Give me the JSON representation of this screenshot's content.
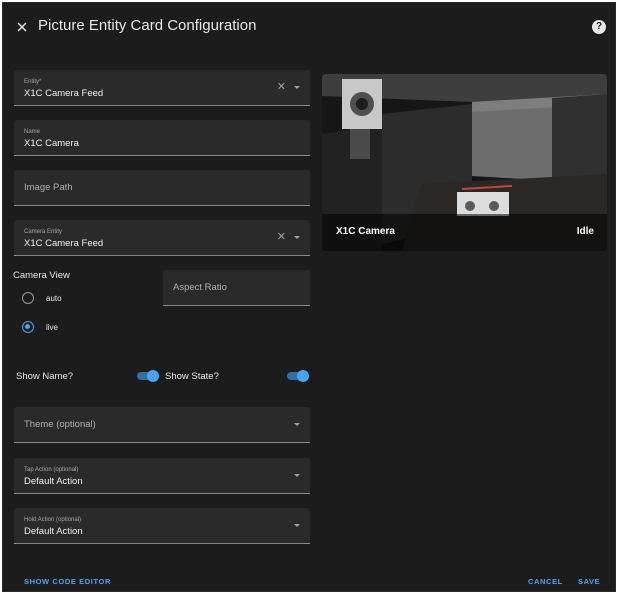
{
  "dialog": {
    "title": "Picture Entity Card Configuration"
  },
  "fields": {
    "entity": {
      "label": "Entity*",
      "value": "X1C Camera Feed"
    },
    "name": {
      "label": "Name",
      "value": "X1C Camera"
    },
    "image_path": {
      "placeholder": "Image Path"
    },
    "camera_entity": {
      "label": "Camera Entity",
      "value": "X1C Camera Feed"
    },
    "aspect_ratio": {
      "placeholder": "Aspect Ratio"
    },
    "theme": {
      "placeholder": "Theme (optional)"
    },
    "tap_action": {
      "label": "Tap Action (optional)",
      "value": "Default Action"
    },
    "hold_action": {
      "label": "Hold Action (optional)",
      "value": "Default Action"
    }
  },
  "camera_view": {
    "label": "Camera View",
    "options": [
      {
        "label": "auto",
        "selected": false
      },
      {
        "label": "live",
        "selected": true
      }
    ]
  },
  "toggles": {
    "show_name": {
      "label": "Show Name?",
      "on": true
    },
    "show_state": {
      "label": "Show State?",
      "on": true
    }
  },
  "preview": {
    "name": "X1C Camera",
    "state": "Idle"
  },
  "footer": {
    "code_editor": "SHOW CODE EDITOR",
    "cancel": "CANCEL",
    "save": "SAVE"
  },
  "colors": {
    "accent": "#4aa3f0",
    "background": "#1c1c1c",
    "field": "#2a2a2a"
  },
  "icons": {
    "close": "close-icon",
    "help": "help-icon",
    "clear": "clear-icon",
    "dropdown": "chevron-down-icon"
  }
}
